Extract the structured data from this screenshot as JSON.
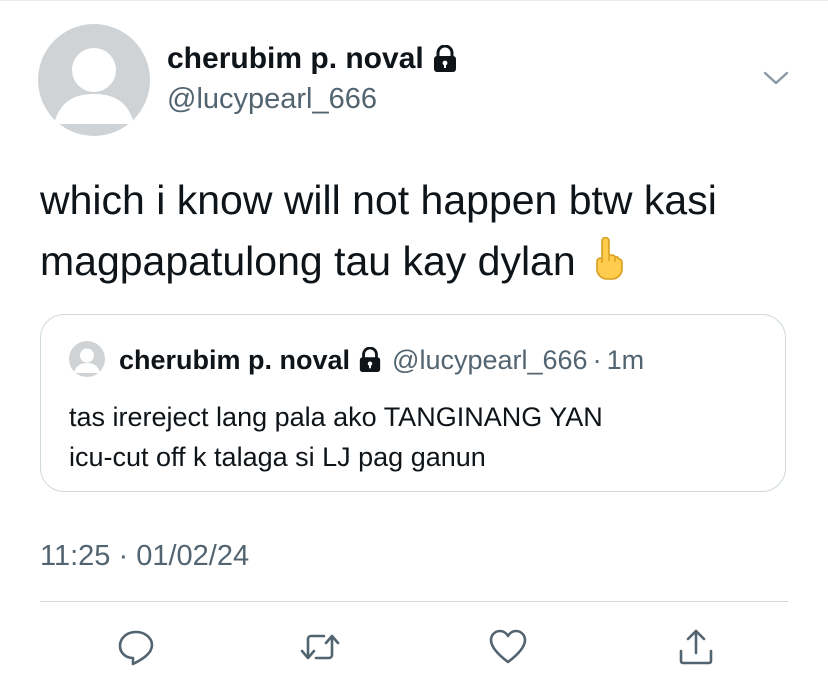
{
  "tweet": {
    "author": {
      "display_name": "cherubim p. noval",
      "handle": "@lucypearl_666",
      "protected_icon": "lock-icon"
    },
    "text_lines": [
      "which i know will not happen btw kasi",
      "magpapatulong tau kay dylan"
    ],
    "emoji": "☝️",
    "timestamp": "11:25 · 01/02/24",
    "menu_icon": "chevron-down-icon"
  },
  "quote": {
    "display_name": "cherubim p. noval",
    "handle": "@lucypearl_666",
    "dot": "·",
    "time": "1m",
    "text_lines": [
      "tas irereject lang pala ako TANGINANG YAN",
      "icu-cut off k talaga si LJ pag ganun"
    ]
  },
  "actions": [
    {
      "name": "reply",
      "icon": "reply-icon"
    },
    {
      "name": "retweet",
      "icon": "retweet-icon"
    },
    {
      "name": "like",
      "icon": "heart-icon"
    },
    {
      "name": "share",
      "icon": "share-icon"
    }
  ],
  "colors": {
    "text": "#0f1419",
    "secondary": "#536471",
    "border": "#cfd9de",
    "avatar": "#cfd3d6"
  }
}
